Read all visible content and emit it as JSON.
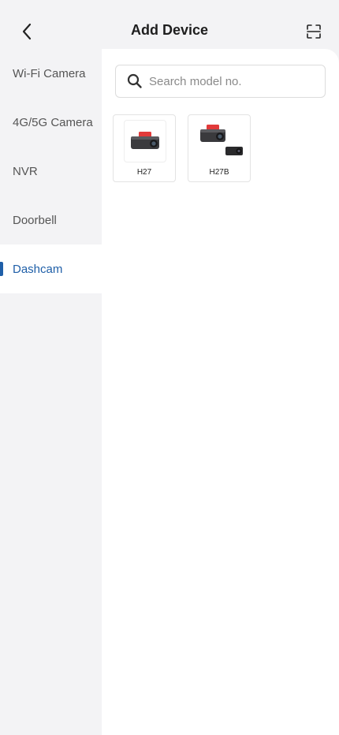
{
  "header": {
    "title": "Add Device",
    "back_icon": "chevron-left-icon",
    "scan_icon": "scan-frame-icon"
  },
  "sidebar": {
    "items": [
      {
        "label": "Wi-Fi Camera",
        "active": false
      },
      {
        "label": "4G/5G Camera",
        "active": false
      },
      {
        "label": "NVR",
        "active": false
      },
      {
        "label": "Doorbell",
        "active": false
      },
      {
        "label": "Dashcam",
        "active": true
      }
    ]
  },
  "search": {
    "placeholder": "Search model no.",
    "value": ""
  },
  "devices": [
    {
      "model": "H27"
    },
    {
      "model": "H27B"
    }
  ],
  "colors": {
    "accent": "#1f5fa8",
    "background": "#f3f3f5",
    "panel": "#ffffff",
    "device_red": "#e23a3a"
  }
}
